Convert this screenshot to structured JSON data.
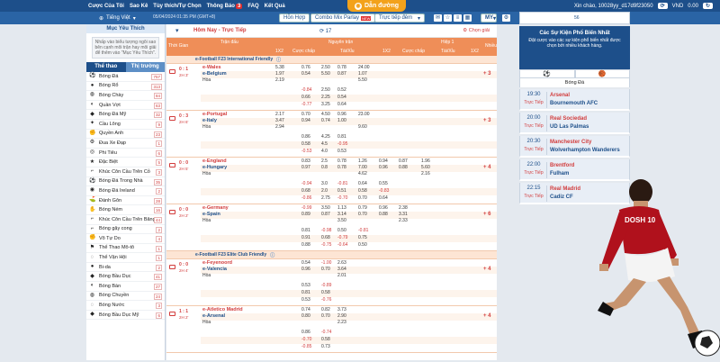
{
  "topbar": {
    "menu": [
      "Cược Của Tôi",
      "Sao Kê",
      "Tùy thích/Tự Chọn",
      "Thông Báo",
      "FAQ",
      "Kết Quả"
    ],
    "notif_count": "3",
    "logo": "Dẫn đường",
    "user": "Xin chào, 10028yy_d17d9f23050",
    "currency": "VND",
    "balance": "0.00"
  },
  "secbar": {
    "language": "Tiếng Việt",
    "datetime": "05/04/2024 01:35 PM (GMT+8)",
    "btn_help": "Hỗn Hợp",
    "btn_parlay": "Combo Mix Parlay",
    "btn_parlay_badge": "NEW",
    "btn_sort": "Trực tiếp đêm",
    "btn_odds": "MY"
  },
  "leftpanel": {
    "header": "Mục Yêu Thích",
    "message": "Nhấp vào biểu tượng ngôi sao bên cạnh môi trận hay môi giải để thêm vào \"Mục Yêu Thích\".",
    "tab_sports": "Thể thao",
    "tab_market": "Thị trường",
    "sports": [
      {
        "name": "Bóng Đá",
        "count": "757",
        "icon": "soccer-icon"
      },
      {
        "name": "Bóng Rổ",
        "count": "313",
        "icon": "basketball-icon"
      },
      {
        "name": "Bóng Chày",
        "count": "84",
        "icon": "baseball-icon"
      },
      {
        "name": "Quần Vợt",
        "count": "63",
        "icon": "tennis-icon"
      },
      {
        "name": "Bóng Đá Mỹ",
        "count": "32",
        "icon": "football-icon"
      },
      {
        "name": "Cầu Lông",
        "count": "9",
        "icon": "badminton-icon"
      },
      {
        "name": "Quyền Anh",
        "count": "23",
        "icon": "boxing-icon"
      },
      {
        "name": "Đua Xe Đạp",
        "count": "1",
        "icon": "cycling-icon"
      },
      {
        "name": "Phi Tiêu",
        "count": "6",
        "icon": "darts-icon"
      },
      {
        "name": "Đặc Biệt",
        "count": "5",
        "icon": "special-icon"
      },
      {
        "name": "Khúc Côn Cầu Trên Cỏ",
        "count": "3",
        "icon": "field-hockey-icon"
      },
      {
        "name": "Bóng Đá Trong Nhà",
        "count": "35",
        "icon": "futsal-icon"
      },
      {
        "name": "Bóng Đá Ireland",
        "count": "2",
        "icon": "gaelic-icon"
      },
      {
        "name": "Đánh Gôn",
        "count": "28",
        "icon": "golf-icon"
      },
      {
        "name": "Bóng Ném",
        "count": "16",
        "icon": "handball-icon"
      },
      {
        "name": "Khúc Côn Cầu Trên Băng",
        "count": "44",
        "icon": "hockey-icon"
      },
      {
        "name": "Bóng gậy cong",
        "count": "2",
        "icon": "hurling-icon"
      },
      {
        "name": "Võ Tự Do",
        "count": "4",
        "icon": "mma-icon"
      },
      {
        "name": "Thể Thao Mô-tô",
        "count": "1",
        "icon": "motorsport-icon"
      },
      {
        "name": "Thể Vận Hội",
        "count": "1",
        "icon": "olympics-icon"
      },
      {
        "name": "Bi-da",
        "count": "2",
        "icon": "pool-icon"
      },
      {
        "name": "Bóng Bầu Dục",
        "count": "41",
        "icon": "rugby-icon"
      },
      {
        "name": "Bóng Bàn",
        "count": "27",
        "icon": "table-tennis-icon"
      },
      {
        "name": "Bóng Chuyền",
        "count": "24",
        "icon": "volleyball-icon"
      },
      {
        "name": "Bóng Nước",
        "count": "3",
        "icon": "water-polo-icon"
      },
      {
        "name": "Bóng Bầu Dục Mỹ",
        "count": "6",
        "icon": "rugby-league-icon"
      }
    ]
  },
  "main": {
    "live_title": "Hôm Nay - Trực Tiếp",
    "live_count": "17",
    "pick_label": "Chọn giải",
    "headers": {
      "time": "Thời Gian",
      "match": "Trận đấu",
      "full": "Nguyên trận",
      "half": "Hiệp 1",
      "more": "Nhiều",
      "x12": "1X2",
      "hdp": "Cược chấp",
      "ou": "Tài/Xỉu"
    },
    "leagues": [
      {
        "name": "e-Football F23 International Friendly",
        "matches": [
          {
            "score": "0 : 1",
            "clock": "2H 3'",
            "home": "e-Wales",
            "away": "e-Belgium",
            "draw": "Hòa",
            "more": "+ 3",
            "rows": [
              [
                "5.38",
                "0.76",
                "2.50",
                "0.78",
                "24.00"
              ],
              [
                "1.97",
                "0.54",
                "5.50",
                "0.87",
                "1.07"
              ],
              [
                "2.19",
                "",
                "",
                "",
                "5.50"
              ],
              [
                "",
                "-0.84",
                "2.50",
                "0.52",
                ""
              ],
              [
                "",
                "0.66",
                "2.25",
                "0.54",
                ""
              ],
              [
                "",
                "-0.77",
                "3.25",
                "0.64",
                ""
              ]
            ]
          },
          {
            "score": "0 : 3",
            "clock": "2H 6'",
            "home": "e-Portugal",
            "away": "e-Italy",
            "draw": "Hòa",
            "more": "+ 3",
            "rows": [
              [
                "2.17",
                "0.70",
                "4.50",
                "0.96",
                "23.00"
              ],
              [
                "3.47",
                "0.94",
                "0.74",
                "1.00",
                ""
              ],
              [
                "2.94",
                "",
                "",
                "",
                "9.60"
              ],
              [
                "",
                "0.86",
                "4.25",
                "0.81",
                ""
              ],
              [
                "",
                "0.58",
                "4.5",
                "-0.95",
                ""
              ],
              [
                "",
                "-0.53",
                "4.0",
                "0.53",
                ""
              ]
            ]
          },
          {
            "score": "0 : 0",
            "clock": "2H 5'",
            "home": "e-England",
            "away": "e-Hungary",
            "draw": "Hòa",
            "more": "+ 4",
            "rows": [
              [
                "",
                "0.83",
                "2.5",
                "0.78",
                "1.26",
                "0.94",
                "0.87",
                "1.96"
              ],
              [
                "",
                "0.97",
                "0.8",
                "0.78",
                "7.00",
                "0.96",
                "0.88",
                "5.60"
              ],
              [
                "",
                "",
                "",
                "",
                "4.62",
                "",
                "",
                "2.16"
              ],
              [
                "",
                "-0.94",
                "3.0",
                "-0.81",
                "0.64",
                "0.55",
                ""
              ],
              [
                "",
                "0.68",
                "2.0",
                "0.51",
                "0.58",
                "-0.83",
                ""
              ],
              [
                "",
                "-0.86",
                "2.75",
                "-0.70",
                "0.70",
                "0.64",
                ""
              ]
            ]
          },
          {
            "score": "0 : 0",
            "clock": "2H 2'",
            "home": "e-Germany",
            "away": "e-Spain",
            "draw": "Hòa",
            "more": "+ 6",
            "rows": [
              [
                "",
                "-0.99",
                "3.50",
                "1.13",
                "0.79",
                "0.96",
                "2.38"
              ],
              [
                "",
                "0.89",
                "0.87",
                "3.14",
                "0.70",
                "0.88",
                "3.31"
              ],
              [
                "",
                "",
                "",
                "3.50",
                "",
                "",
                "2.33"
              ],
              [
                "",
                "0.81",
                "-0.98",
                "0.50",
                "-0.81",
                ""
              ],
              [
                "",
                "0.91",
                "0.68",
                "-0.79",
                "0.75",
                ""
              ],
              [
                "",
                "0.88",
                "-0.75",
                "-0.64",
                "0.50",
                ""
              ]
            ]
          }
        ]
      },
      {
        "name": "e-Football F23 Elite Club Friendly",
        "matches": [
          {
            "score": "0 : 0",
            "clock": "2H 4'",
            "home": "e-Feyenoord",
            "away": "e-Valencia",
            "draw": "Hòa",
            "more": "+ 4",
            "rows": [
              [
                "",
                "0.54",
                "-1.00",
                "2.63",
                ""
              ],
              [
                "",
                "0.96",
                "0.70",
                "3.64",
                ""
              ],
              [
                "",
                "",
                "",
                "2.01",
                ""
              ],
              [
                "",
                "0.53",
                "-0.89",
                ""
              ],
              [
                "",
                "0.81",
                "0.58",
                ""
              ],
              [
                "",
                "0.53",
                "-0.76",
                ""
              ]
            ]
          },
          {
            "score": "1 : 1",
            "clock": "2H 2'",
            "home": "e-Atletico Madrid",
            "away": "e-Arsenal",
            "draw": "Hòa",
            "more": "+ 4",
            "rows": [
              [
                "",
                "0.74",
                "0.82",
                "3.73",
                ""
              ],
              [
                "",
                "0.80",
                "0.70",
                "2.90",
                ""
              ],
              [
                "",
                "",
                "",
                "2.23",
                ""
              ],
              [
                "",
                "0.86",
                "-0.74",
                ""
              ],
              [
                "",
                "-0.70",
                "0.58",
                ""
              ],
              [
                "",
                "-0.85",
                "0.73",
                ""
              ]
            ]
          }
        ]
      }
    ]
  },
  "rightpanel": {
    "search_value": "56",
    "title": "Các Sự Kiện Phổ Biến Nhất",
    "subtitle": "Đặt cược vào các sự kiện phổ biến nhất được chọn bởi nhiều khách hàng.",
    "category": "Bóng Đá",
    "fixtures": [
      {
        "time": "19:30",
        "live": "Trực Tiếp",
        "home": "Arsenal",
        "away": "Bournemouth AFC"
      },
      {
        "time": "20:00",
        "live": "Trực Tiếp",
        "home": "Real Sociedad",
        "away": "UD Las Palmas"
      },
      {
        "time": "20:30",
        "live": "Trực Tiếp",
        "home": "Manchester City",
        "away": "Wolverhampton Wanderers"
      },
      {
        "time": "22:00",
        "live": "Trực Tiếp",
        "home": "Brentford",
        "away": "Fulham"
      },
      {
        "time": "22:15",
        "live": "Trực Tiếp",
        "home": "Real Madrid",
        "away": "Cadiz CF"
      }
    ]
  },
  "player": {
    "jersey_text": "DOSH 10",
    "jersey_number": "10"
  }
}
